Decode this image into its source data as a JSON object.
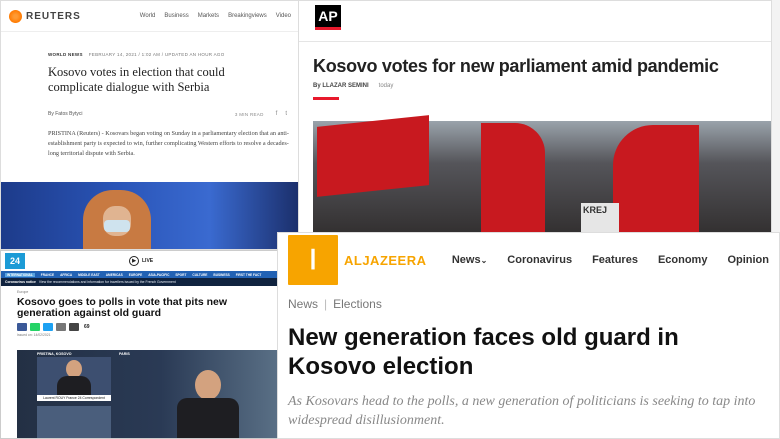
{
  "reuters": {
    "logo": "REUTERS",
    "nav": [
      "World",
      "Business",
      "Markets",
      "Breakingviews",
      "Video"
    ],
    "section": "WORLD NEWS",
    "meta": "FEBRUARY 14, 2021 / 1:02 AM / UPDATED AN HOUR AGO",
    "headline": "Kosovo votes in election that could complicate dialogue with Serbia",
    "byline": "By Fatos Bytyci",
    "read_time": "3 MIN READ",
    "social": [
      "f",
      "t"
    ],
    "body": "PRISTINA (Reuters) - Kosovars began voting on Sunday in a parliamentary election that an anti-establishment party is expected to win, further complicating Western efforts to resolve a decades-long territorial dispute with Serbia."
  },
  "ap": {
    "logo": "AP",
    "headline": "Kosovo votes for new parliament amid pandemic",
    "byline": "By LLAZAR SEMINI",
    "date": "today",
    "sign_text": "KREJ"
  },
  "france24": {
    "logo": "24",
    "live": "LIVE",
    "nav": [
      "INTERNATIONAL",
      "FRANCE",
      "AFRICA",
      "MIDDLE EAST",
      "AMERICAS",
      "EUROPE",
      "ASIA-PACIFIC",
      "SPORT",
      "CULTURE",
      "BUSINESS",
      "FIRST THE FACT"
    ],
    "notice_label": "Coronavirus notice",
    "notice_text": "View the recommendations and information for travellers issued by the French Government",
    "crumb": "Europe",
    "headline": "Kosovo goes to polls in vote that pits new generation against old guard",
    "share_count": "69",
    "issued": "Issued on: 14/02/2021",
    "video_location": "PRISTINA, KOSOVO",
    "video_paris": "PARIS",
    "reporter": "Laurent ROUY France 24 Correspondent"
  },
  "aljazeera": {
    "wordmark": "ALJAZEERA",
    "nav": [
      "News",
      "Coronavirus",
      "Features",
      "Economy",
      "Opinion"
    ],
    "crumb_1": "News",
    "crumb_sep": "|",
    "crumb_2": "Elections",
    "headline": "New generation faces old guard in Kosovo election",
    "dek": "As Kosovars head to the polls, a new generation of politicians is seeking to tap into widespread disillusionment."
  }
}
